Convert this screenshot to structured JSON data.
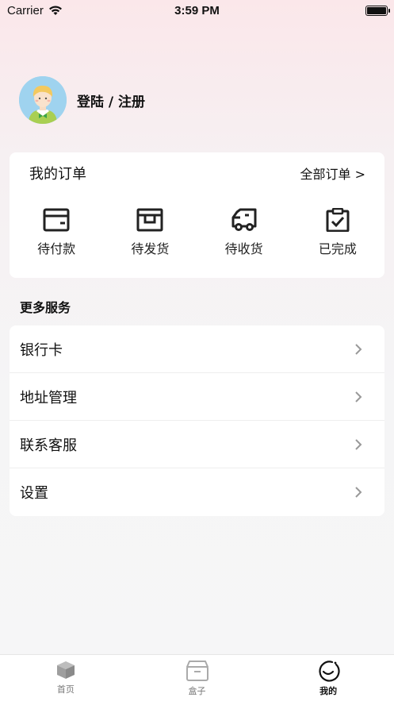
{
  "status_bar": {
    "carrier": "Carrier",
    "time": "3:59 PM"
  },
  "profile": {
    "login_label": "登陆 / 注册"
  },
  "orders": {
    "title": "我的订单",
    "view_all": "全部订单 >",
    "items": [
      {
        "label": "待付款",
        "icon": "wallet-icon"
      },
      {
        "label": "待发货",
        "icon": "box-icon"
      },
      {
        "label": "待收货",
        "icon": "truck-icon"
      },
      {
        "label": "已完成",
        "icon": "clipboard-check-icon"
      }
    ]
  },
  "services": {
    "title": "更多服务",
    "items": [
      {
        "label": "银行卡"
      },
      {
        "label": "地址管理"
      },
      {
        "label": "联系客服"
      },
      {
        "label": "设置"
      }
    ]
  },
  "tabbar": {
    "tabs": [
      {
        "label": "首页",
        "icon": "cube-icon",
        "active": false
      },
      {
        "label": "盒子",
        "icon": "box-icon",
        "active": false
      },
      {
        "label": "我的",
        "icon": "smile-icon",
        "active": true
      }
    ]
  }
}
